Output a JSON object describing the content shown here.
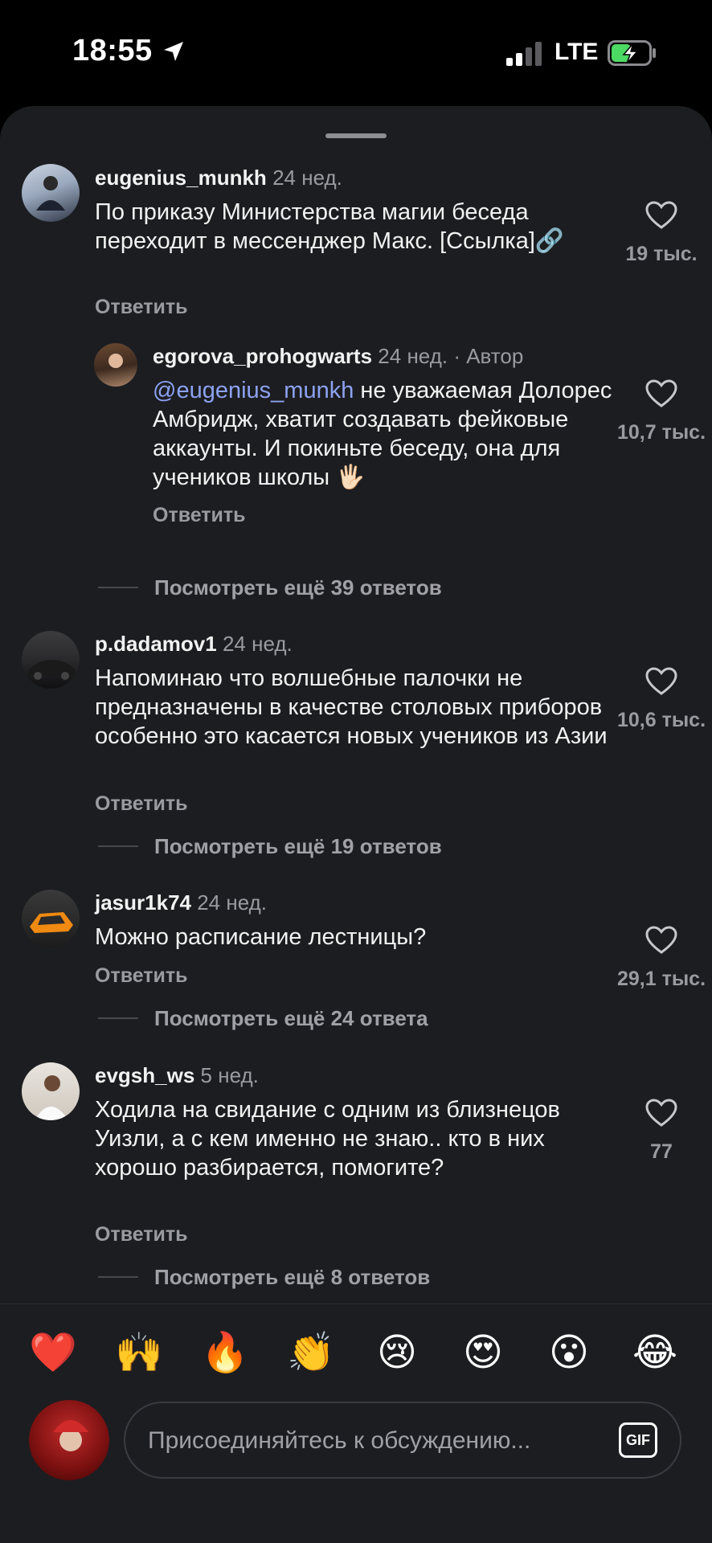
{
  "status": {
    "time": "18:55",
    "network": "LTE"
  },
  "comments": [
    {
      "username": "eugenius_munkh",
      "ago": "24 нед.",
      "author": "",
      "text": "По приказу Министерства магии беседа переходит в мессенджер Макс. [Ссылка]🔗",
      "mention": "",
      "reply": "Ответить",
      "likes": "19 тыс."
    },
    {
      "username": "egorova_prohogwarts",
      "ago": "24 нед.",
      "author": "· Автор",
      "mention": "@eugenius_munkh",
      "text": " не уважаемая Долорес Амбридж, хватит создавать фейковые аккаунты. И покиньте беседу, она для учеников школы 🖐🏻",
      "reply": "Ответить",
      "likes": "10,7 тыс."
    },
    {
      "username": "p.dadamov1",
      "ago": "24 нед.",
      "author": "",
      "text": "Напоминаю что волшебные палочки не предназначены в качестве столовых приборов особенно это касается новых учеников из Азии",
      "mention": "",
      "reply": "Ответить",
      "likes": "10,6 тыс."
    },
    {
      "username": "jasur1k74",
      "ago": "24 нед.",
      "author": "",
      "text": "Можно расписание лестницы?",
      "mention": "",
      "reply": "Ответить",
      "likes": "29,1 тыс."
    },
    {
      "username": "evgsh_ws",
      "ago": "5 нед.",
      "author": "",
      "text": "Ходила на свидание с одним из близнецов Уизли, а с кем именно не знаю.. кто в них хорошо разбирается, помогите?",
      "mention": "",
      "reply": "Ответить",
      "likes": "77"
    }
  ],
  "view_more": [
    "Посмотреть ещё 39 ответов",
    "Посмотреть ещё 19 ответов",
    "Посмотреть ещё 24 ответа",
    "Посмотреть ещё 8 ответов"
  ],
  "reactions": [
    "❤️",
    "🙌",
    "🔥",
    "👏",
    "😢",
    "😍",
    "😮",
    "😂"
  ],
  "composer": {
    "placeholder": "Присоединяйтесь к обсуждению...",
    "gif_label": "GIF"
  },
  "colors": {
    "sheet_bg": "#1c1d21",
    "mention": "#8da2f2",
    "muted": "#9a9aa0",
    "battery_charge": "#4cd964"
  }
}
